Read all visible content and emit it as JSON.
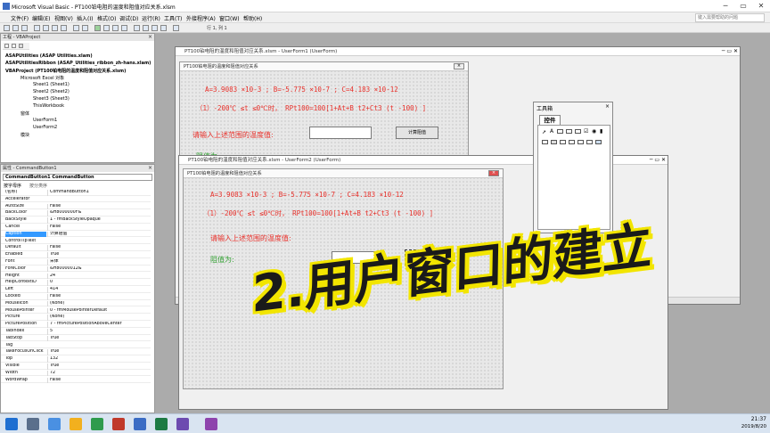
{
  "window": {
    "title": "Microsoft Visual Basic - PT100铂电阻的温度和阻值对应关系.xlsm"
  },
  "menu": {
    "items": [
      "文件(F)",
      "编辑(E)",
      "视图(V)",
      "插入(I)",
      "格式(O)",
      "调试(D)",
      "运行(R)",
      "工具(T)",
      "外接程序(A)",
      "窗口(W)",
      "帮助(H)"
    ],
    "help_placeholder": "键入需要帮助的问题"
  },
  "toolbar": {
    "position": "行 1, 列 1"
  },
  "project": {
    "header": "工程 - VBAProject",
    "items": [
      "ASAPUtilities (ASAP Utilities.xlam)",
      "ASAPUtilitiesRibbon (ASAP_Utilities_ribbon_zh-hans.xlam)",
      "VBAProject (PT100铂电阻的温度和阻值对应关系.xlsm)",
      "Microsoft Excel 对象",
      "Sheet1 (Sheet1)",
      "Sheet2 (Sheet2)",
      "Sheet3 (Sheet3)",
      "ThisWorkbook",
      "窗体",
      "UserForm1",
      "UserForm2",
      "模块"
    ]
  },
  "properties": {
    "header": "属性 - CommandButton1",
    "object": "CommandButton1 CommandButton",
    "tabs": [
      "按字母序",
      "按分类序"
    ],
    "rows": [
      [
        "(名称)",
        "CommandButton1"
      ],
      [
        "Accelerator",
        ""
      ],
      [
        "AutoSize",
        "False"
      ],
      [
        "BackColor",
        "&H8000000F&"
      ],
      [
        "BackStyle",
        "1 - fmBackStyleOpaque"
      ],
      [
        "Cancel",
        "False"
      ],
      [
        "Caption",
        "计算阻值"
      ],
      [
        "ControlTipText",
        ""
      ],
      [
        "Default",
        "False"
      ],
      [
        "Enabled",
        "True"
      ],
      [
        "Font",
        "宋体"
      ],
      [
        "ForeColor",
        "&H80000012&"
      ],
      [
        "Height",
        "24"
      ],
      [
        "HelpContextID",
        "0"
      ],
      [
        "Left",
        "414"
      ],
      [
        "Locked",
        "False"
      ],
      [
        "MouseIcon",
        "(None)"
      ],
      [
        "MousePointer",
        "0 - fmMousePointerDefault"
      ],
      [
        "Picture",
        "(None)"
      ],
      [
        "PicturePosition",
        "7 - fmPicturePositionAboveCenter"
      ],
      [
        "TabIndex",
        "5"
      ],
      [
        "TabStop",
        "True"
      ],
      [
        "Tag",
        ""
      ],
      [
        "TakeFocusOnClick",
        "True"
      ],
      [
        "Top",
        "132"
      ],
      [
        "Visible",
        "True"
      ],
      [
        "Width",
        "72"
      ],
      [
        "WordWrap",
        "False"
      ]
    ]
  },
  "userform1": {
    "window_title": "PT100铂电阻的温度和阻值对应关系.xlsm - UserForm1 (UserForm)",
    "form_title": "PT100铂电阻的温度和阻值对应关系",
    "line1": "A=3.9083 ×10-3 ; B=-5.775 ×10-7 ; C=4.183 ×10-12",
    "line2": "（1）-200℃ ≤t ≤0℃时， RPt100=100[1+At+B t2+Ct3 (t -100) ]",
    "prompt": "请输入上述范围的温度值:",
    "result_label": "阻值为:",
    "button": "计算阻值"
  },
  "userform2": {
    "window_title": "PT100铂电阻的温度和阻值对应关系.xlsm - UserForm2 (UserForm)",
    "form_title": "PT100铂电阻的温度和阻值对应关系",
    "line1": "A=3.9083 ×10-3 ; B=-5.775 ×10-7 ; C=4.183 ×10-12",
    "line2": "（1）-200℃ ≤t ≤0℃时， RPt100=100[1+At+B t2+Ct3 (t -100) ]",
    "prompt": "请输入上述范围的温度值:",
    "result_label": "阻值为:",
    "button": "计算阻值"
  },
  "toolbox": {
    "title": "工具箱",
    "tab": "控件"
  },
  "overlay": {
    "text": "2.用户窗口的建立"
  },
  "clock": {
    "time": "21:37",
    "date": "2019/8/20"
  },
  "colors": {
    "red_text": "#e8302a",
    "green_text": "#33a033",
    "overlay_fill": "#1a1a1a",
    "overlay_outline": "#f2e500"
  }
}
